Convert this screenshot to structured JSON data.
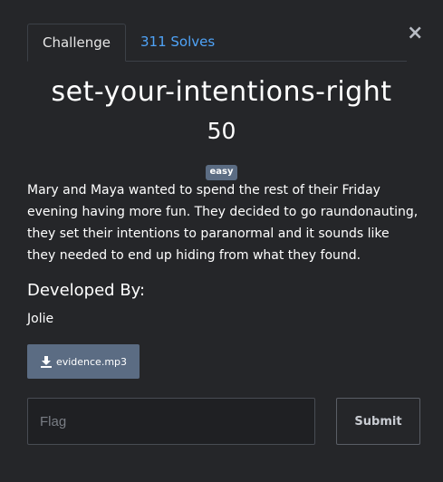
{
  "modal": {
    "close_label": "×"
  },
  "tabs": [
    {
      "label": "Challenge",
      "active": true
    },
    {
      "label": "311 Solves",
      "active": false
    }
  ],
  "challenge": {
    "name": "set-your-intentions-right",
    "points": "50",
    "difficulty": "easy",
    "description": "Mary and Maya wanted to spend the rest of their Friday evening having more fun. They decided to go raundonauting, they set their intentions to paranormal and it sounds like they needed to end up hiding from what they found.",
    "developed_by_heading": "Developed By:",
    "developer": "Jolie",
    "file": {
      "icon": "download-icon",
      "label": "evidence.mp3"
    }
  },
  "flag_form": {
    "placeholder": "Flag",
    "value": "",
    "submit_label": "Submit"
  },
  "colors": {
    "background": "#252629",
    "link": "#4fa3f7",
    "badge": "#5b6c83",
    "file_button": "#5b6c83"
  }
}
